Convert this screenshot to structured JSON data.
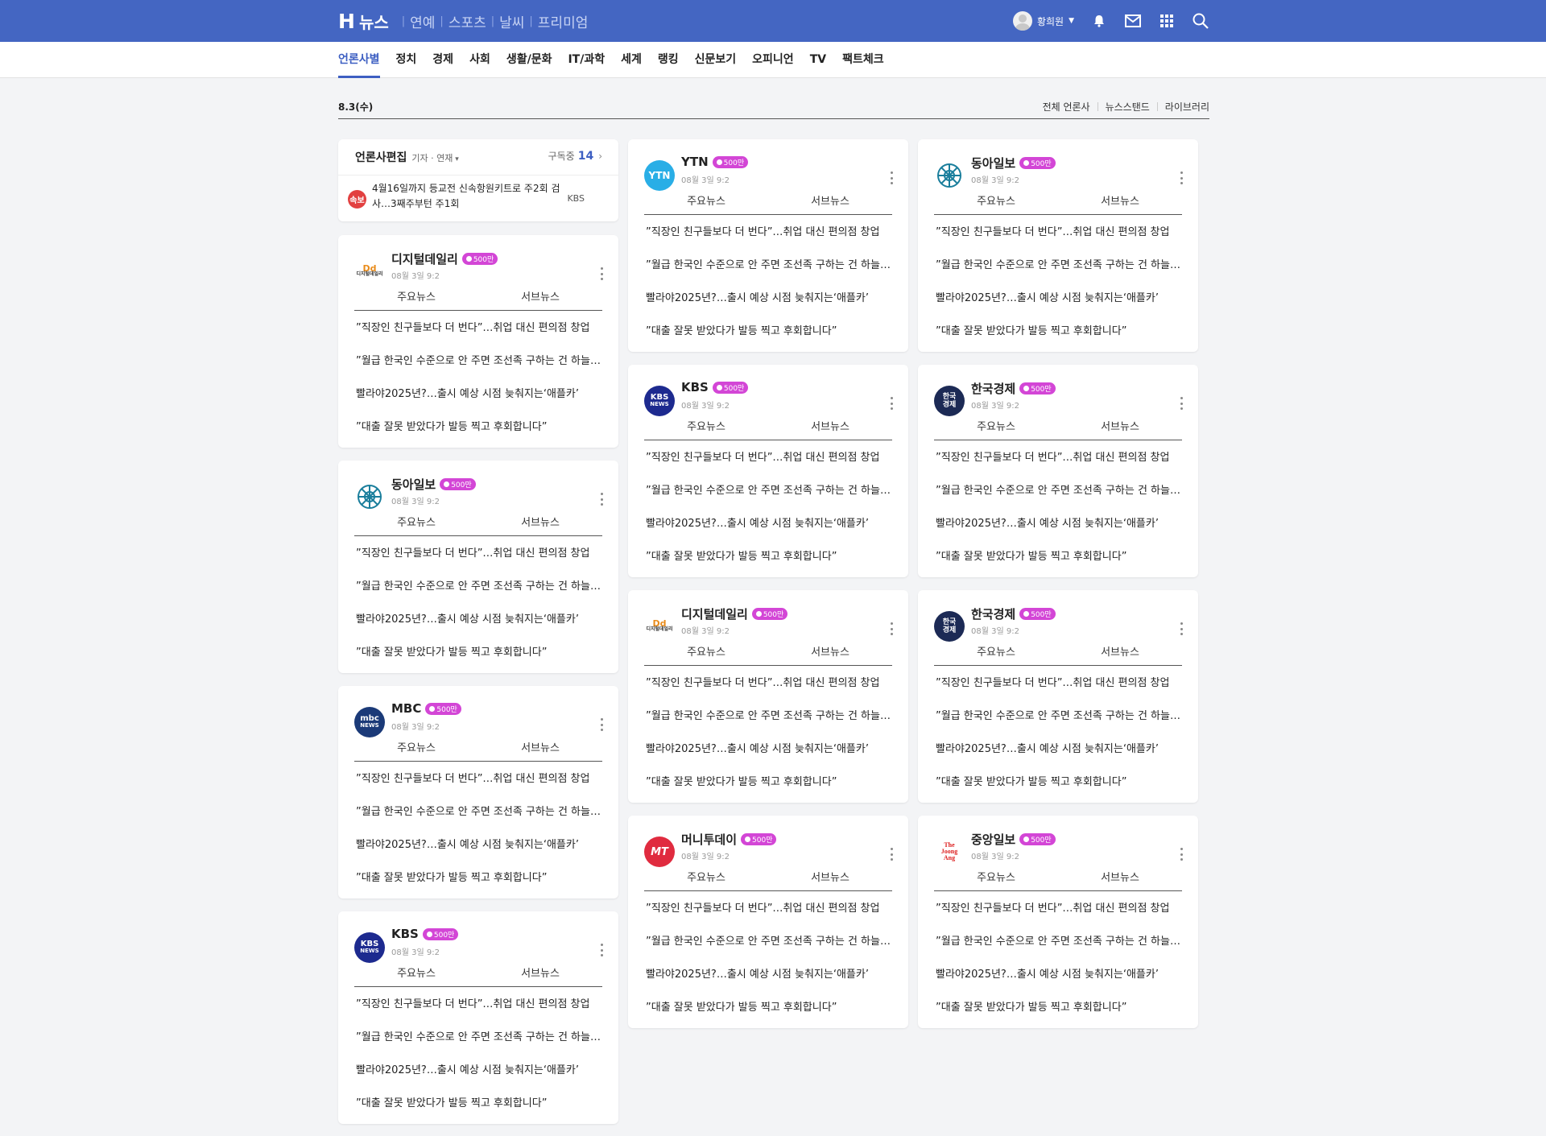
{
  "topbar": {
    "logo_letter": "H",
    "logo_text": "뉴스",
    "services": [
      "연예",
      "스포츠",
      "날씨",
      "프리미엄"
    ],
    "user_name": "황희원",
    "icons": [
      "bell-icon",
      "mail-icon",
      "grid-icon",
      "search-icon"
    ]
  },
  "tabs": [
    "언론사별",
    "정치",
    "경제",
    "사회",
    "생활/문화",
    "IT/과학",
    "세계",
    "랭킹",
    "신문보기",
    "오피니언",
    "TV",
    "팩트체크"
  ],
  "datebar": {
    "date": "8.3(수)",
    "links": [
      "전체 언론사",
      "뉴스스탠드",
      "라이브러리"
    ]
  },
  "edit_card": {
    "title": "언론사편집",
    "sub": "기자 · 연재",
    "subscribed_label": "구독중",
    "subscribed_count": "14",
    "breaking_badge": "속보",
    "breaking_text": "4월16일까지 등교전 신속항원키트로 주2회 검사…3째주부턴 주1회",
    "breaking_source": "KBS"
  },
  "card_common": {
    "tab_main": "주요뉴스",
    "tab_sub": "서브뉴스",
    "badge": "500만",
    "time": "08월 3일 9:2",
    "headlines": [
      "”직장인 친구들보다 더 번다”…취업 대신 편의점 창업",
      "”월급 한국인 수준으로 안 주면 조선족 구하는 건 하늘의 별따기”",
      "빨라야2025년?…출시 예상 시점 늦춰지는‘애플카’",
      "”대출 잘못 받았다가 발등 찍고 후회합니다”"
    ]
  },
  "columns": [
    [
      {
        "name": "디지털데일리",
        "logo": "디지털데일리",
        "logo_style": "dd"
      },
      {
        "name": "동아일보",
        "logo": "동아",
        "logo_style": "donga"
      },
      {
        "name": "MBC",
        "logo": "mbc NEWS",
        "logo_style": "mbc"
      },
      {
        "name": "KBS",
        "logo": "KBS NEWS",
        "logo_style": "kbs"
      }
    ],
    [
      {
        "name": "YTN",
        "logo": "YTN",
        "logo_style": "ytn"
      },
      {
        "name": "KBS",
        "logo": "KBS NEWS",
        "logo_style": "kbs"
      },
      {
        "name": "디지털데일리",
        "logo": "디지털데일리",
        "logo_style": "dd"
      },
      {
        "name": "머니투데이",
        "logo": "MT",
        "logo_style": "mt"
      }
    ],
    [
      {
        "name": "동아일보",
        "logo": "동아",
        "logo_style": "donga"
      },
      {
        "name": "한국경제",
        "logo": "한국경제",
        "logo_style": "hk"
      },
      {
        "name": "한국경제",
        "logo": "한국경제",
        "logo_style": "hk"
      },
      {
        "name": "중앙일보",
        "logo": "The JoongAng",
        "logo_style": "ja"
      }
    ]
  ],
  "colors": {
    "brand": "#4466c2",
    "badge": "#d346d6",
    "active_tab": "#3d5fc2"
  }
}
